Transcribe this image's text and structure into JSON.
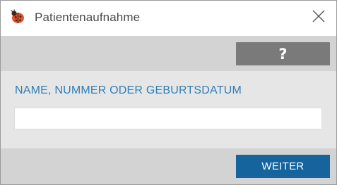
{
  "window": {
    "title": "Patientenaufnahme",
    "app_icon": "ladybug-logo-icon",
    "close_icon": "close-icon"
  },
  "toolbar": {
    "help_label": "?"
  },
  "form": {
    "field_label": "NAME, NUMMER ODER GEBURTSDATUM",
    "field_value": "",
    "field_placeholder": ""
  },
  "footer": {
    "next_label": "WEITER"
  },
  "colors": {
    "accent": "#15649e",
    "label": "#2f7fb5",
    "help_button": "#7a7a7a",
    "panel": "#d3d3d3",
    "content_bg": "#e6e6e6"
  }
}
